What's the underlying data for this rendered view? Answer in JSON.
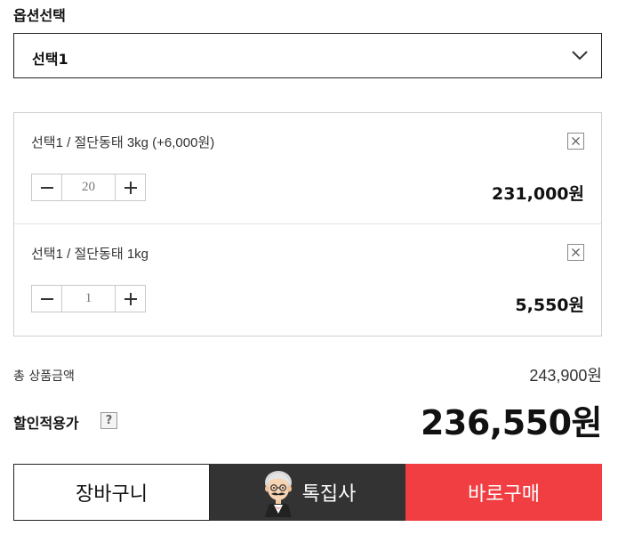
{
  "option_section": {
    "label": "옵션선택"
  },
  "select": {
    "value": "선택1",
    "icon": "chevron-down-icon"
  },
  "options": [
    {
      "name": "선택1 / 절단동태 3kg (+6,000원)",
      "quantity": "20",
      "price": "231,000원"
    },
    {
      "name": "선택1 / 절단동태 1kg",
      "quantity": "1",
      "price": "5,550원"
    }
  ],
  "summary": {
    "total_label": "총 상품금액",
    "total_value": "243,900원",
    "discount_label": "할인적용가",
    "help": "?",
    "final_price": "236,550원"
  },
  "actions": {
    "cart": "장바구니",
    "special": "톡집사",
    "buy": "바로구매"
  },
  "colors": {
    "buy_bg": "#f03e42",
    "special_bg": "#333333",
    "border": "#cfcfcf"
  }
}
